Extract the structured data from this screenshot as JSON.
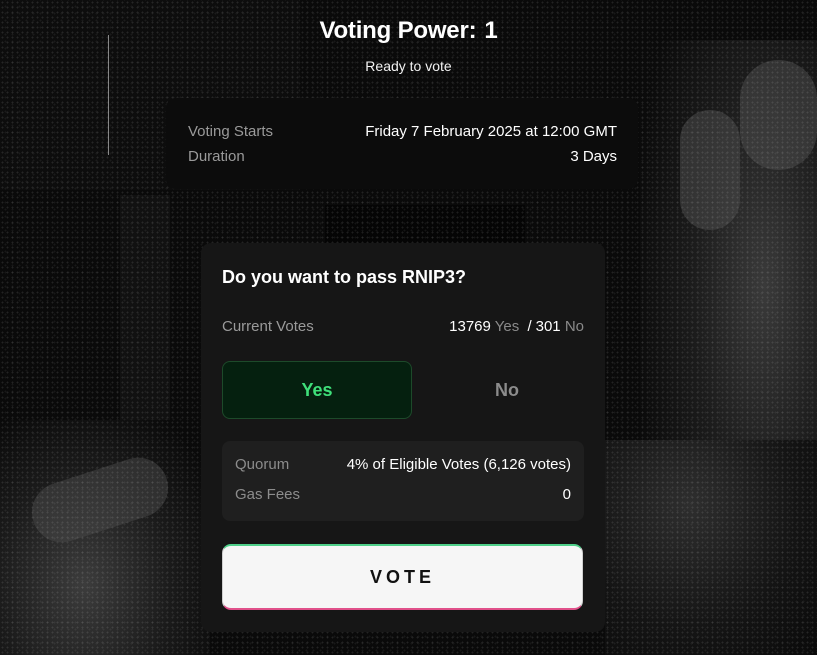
{
  "header": {
    "voting_power_label": "Voting Power:",
    "voting_power_value": "1",
    "status": "Ready to vote"
  },
  "schedule": {
    "start_label": "Voting Starts",
    "start_value": "Friday 7 February 2025 at 12:00 GMT",
    "duration_label": "Duration",
    "duration_value": "3 Days"
  },
  "proposal": {
    "question": "Do you want to pass RNIP3?",
    "current_votes_label": "Current Votes",
    "yes_count": "13769",
    "yes_label": "Yes",
    "separator": "/",
    "no_count": "301",
    "no_label": "No",
    "options": {
      "yes": "Yes",
      "no": "No"
    },
    "selected": "yes",
    "quorum_label": "Quorum",
    "quorum_value": "4% of Eligible Votes (6,126 votes)",
    "gas_label": "Gas Fees",
    "gas_value": "0",
    "vote_button": "VOTE"
  },
  "colors": {
    "yes_accent": "#3fe07a",
    "button_top_border": "#4fd08a",
    "button_bottom_border": "#e0508a"
  }
}
